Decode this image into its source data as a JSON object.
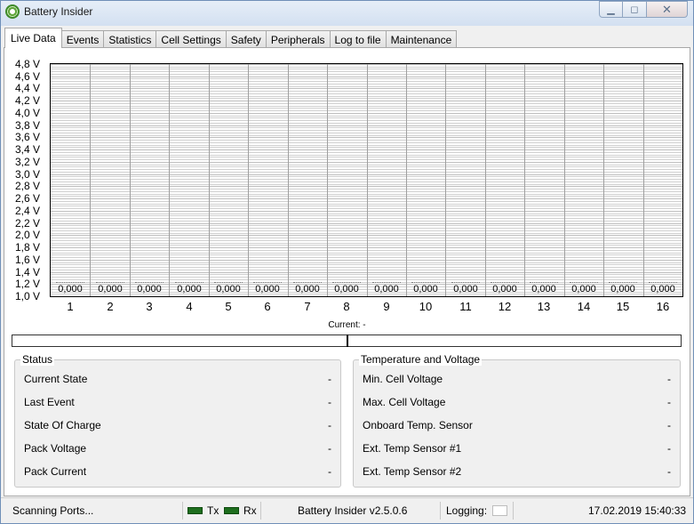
{
  "window": {
    "title": "Battery Insider",
    "icon": "battery-insider-app-icon",
    "minimize": "▁",
    "maximize": "◻",
    "close": "✕"
  },
  "tabs": [
    "Live Data",
    "Events",
    "Statistics",
    "Cell Settings",
    "Safety",
    "Peripherals",
    "Log to file",
    "Maintenance"
  ],
  "active_tab": "Live Data",
  "chart_data": {
    "type": "bar",
    "categories": [
      "1",
      "2",
      "3",
      "4",
      "5",
      "6",
      "7",
      "8",
      "9",
      "10",
      "11",
      "12",
      "13",
      "14",
      "15",
      "16"
    ],
    "values": [
      0,
      0,
      0,
      0,
      0,
      0,
      0,
      0,
      0,
      0,
      0,
      0,
      0,
      0,
      0,
      0
    ],
    "value_labels": [
      "0,000",
      "0,000",
      "0,000",
      "0,000",
      "0,000",
      "0,000",
      "0,000",
      "0,000",
      "0,000",
      "0,000",
      "0,000",
      "0,000",
      "0,000",
      "0,000",
      "0,000",
      "0,000"
    ],
    "ylim": [
      1.0,
      4.8
    ],
    "yticks": [
      "4,8 V",
      "4,6 V",
      "4,4 V",
      "4,2 V",
      "4,0 V",
      "3,8 V",
      "3,6 V",
      "3,4 V",
      "3,2 V",
      "3,0 V",
      "2,8 V",
      "2,6 V",
      "2,4 V",
      "2,2 V",
      "2,0 V",
      "1,8 V",
      "1,6 V",
      "1,4 V",
      "1,2 V",
      "1,0 V"
    ],
    "grid": true
  },
  "current": {
    "label": "Current: -",
    "value": null
  },
  "status": {
    "title": "Status",
    "rows": [
      {
        "label": "Current State",
        "value": "-"
      },
      {
        "label": "Last Event",
        "value": "-"
      },
      {
        "label": "State Of Charge",
        "value": "-"
      },
      {
        "label": "Pack Voltage",
        "value": "-"
      },
      {
        "label": "Pack Current",
        "value": "-"
      }
    ]
  },
  "temperature": {
    "title": "Temperature and Voltage",
    "rows": [
      {
        "label": "Min. Cell Voltage",
        "value": "-"
      },
      {
        "label": "Max. Cell Voltage",
        "value": "-"
      },
      {
        "label": "Onboard Temp. Sensor",
        "value": "-"
      },
      {
        "label": "Ext. Temp Sensor #1",
        "value": "-"
      },
      {
        "label": "Ext. Temp Sensor #2",
        "value": "-"
      }
    ]
  },
  "statusbar": {
    "scan": "Scanning Ports...",
    "tx": "Tx",
    "rx": "Rx",
    "version": "Battery Insider v2.5.0.6",
    "logging": "Logging:",
    "datetime": "17.02.2019 15:40:33",
    "led_color": "#1e6e1e"
  }
}
